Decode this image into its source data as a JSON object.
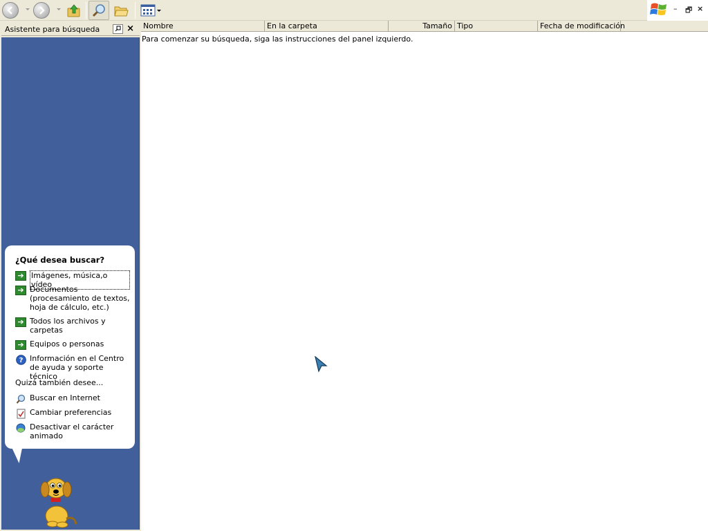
{
  "toolbar": {
    "buttons": [
      {
        "name": "back-icon"
      },
      {
        "name": "forward-icon"
      },
      {
        "name": "folder-up-icon"
      },
      {
        "name": "search-icon"
      },
      {
        "name": "folders-icon"
      },
      {
        "name": "views-icon"
      }
    ]
  },
  "search_pane": {
    "title": "Asistente para búsqueda",
    "close_label": "×",
    "heading": "¿Qué desea buscar?",
    "options": [
      {
        "label": "Imágenes, música,o vídeo",
        "icon": "green-arrow-icon"
      },
      {
        "label": "Documentos (procesamiento de textos, hoja de cálculo, etc.)",
        "icon": "green-arrow-icon"
      },
      {
        "label": "Todos los archivos y carpetas",
        "icon": "green-arrow-icon"
      },
      {
        "label": "Equipos o personas",
        "icon": "green-arrow-icon"
      },
      {
        "label": "Información en el Centro de ayuda y soporte técnico",
        "icon": "help-icon"
      }
    ],
    "also_label": "Quizá también desee...",
    "also_options": [
      {
        "label": "Buscar en Internet",
        "icon": "internet-search-icon"
      },
      {
        "label": "Cambiar preferencias",
        "icon": "preferences-icon"
      },
      {
        "label": "Desactivar el carácter animado",
        "icon": "character-icon"
      }
    ]
  },
  "results": {
    "columns": [
      "Nombre",
      "En la carpeta",
      "Tamaño",
      "Tipo",
      "Fecha de modificación"
    ],
    "hint": "Para comenzar su búsqueda, siga las instrucciones del panel izquierdo."
  },
  "colors": {
    "pane_blue": "#415f9b",
    "toolbar_bg": "#ece9d8",
    "arrow_green": "#2f8a2f"
  }
}
